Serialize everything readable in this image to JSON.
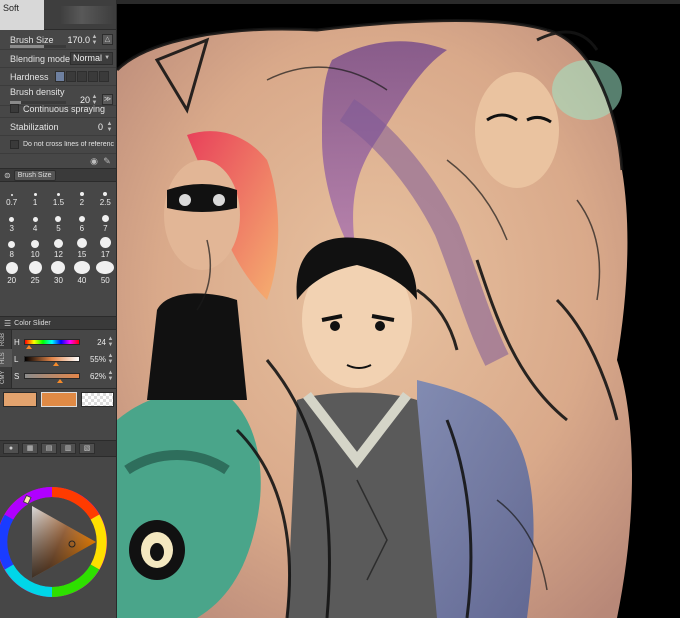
{
  "colors": {
    "panel_bg": "#474747",
    "accent_orange": "#f58a2a",
    "main_color": "#e3a36e",
    "sub_color": "#e08a45",
    "hardness_active": "#6e80a0"
  },
  "brush_tab": {
    "label": "Soft"
  },
  "tool_property": {
    "brush_size_label": "Brush Size",
    "brush_size_value": "170.0",
    "blending_label": "Blending mode",
    "blending_value": "Normal",
    "hardness_label": "Hardness",
    "hardness_level": 1,
    "hardness_steps": 5,
    "density_label": "Brush density",
    "density_value": "20",
    "continuous_label": "Continuous spraying",
    "stabilization_label": "Stabilization",
    "stabilization_value": "0",
    "cross_lines_label": "Do not cross lines of referenc"
  },
  "brush_size_palette": {
    "title": "Brush Size",
    "sizes": [
      "0.7",
      "1",
      "1.5",
      "2",
      "2.5",
      "3",
      "4",
      "5",
      "6",
      "7",
      "8",
      "10",
      "12",
      "15",
      "17",
      "20",
      "25",
      "30",
      "40",
      "50"
    ]
  },
  "color_slider": {
    "title": "Color Slider",
    "mode_tabs": [
      "RGB",
      "HLS",
      "CMY"
    ],
    "h_label": "H",
    "h_value": "24",
    "l_label": "L",
    "l_value": "55%",
    "s_label": "S",
    "s_value": "62%"
  },
  "icons": [
    "brush-size-icon",
    "color-slider-icon",
    "spin-arrows-icon",
    "lock-icon",
    "color-wheel-icon"
  ]
}
